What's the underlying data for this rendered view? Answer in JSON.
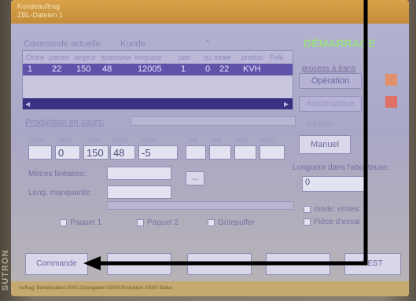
{
  "window": {
    "title_line1": "Kundeauftrag",
    "title_line2": "ZBL-Dateien 1"
  },
  "order": {
    "label": "Commande actuelle:",
    "value": "Kunde",
    "marker": "*"
  },
  "table": {
    "columns": [
      "Ordre",
      "pièces",
      "largeur",
      "épaisseur",
      "longueur",
      "part",
      "qu",
      "totale",
      "produit",
      "Polk"
    ],
    "row": [
      "1",
      "22",
      "150",
      "48",
      "12005",
      "1",
      "0",
      "22",
      "KVH",
      ""
    ]
  },
  "production": {
    "label": "Production en cours:",
    "headers": [
      "Comm.",
      "pièces",
      "largeur",
      "épaiss.",
      "longeur",
      "part",
      "quai",
      "totale",
      "produit"
    ],
    "values": [
      "",
      "0",
      "150",
      "48",
      "-5",
      "",
      "",
      "",
      ""
    ]
  },
  "metres": {
    "label": "Mètres linéaires:",
    "value": ""
  },
  "long": {
    "label": "Long. manquante:",
    "value": ""
  },
  "checkboxes": [
    "Paquet 1",
    "Paquet 2",
    "Gütepuffer"
  ],
  "right_panel": {
    "title": "DÉMARRAGE",
    "process_label": "process à trans",
    "operation_label": "Opération",
    "auto_label": "Automatique",
    "funktion_label": "Funktion",
    "manual_button": "Manuel",
    "longueur_label": "Longueur dans l'abouteuse:",
    "longueur_value": "0",
    "mode_label": "mode: restes",
    "piece_label": "Pièce d'essai"
  },
  "bottom_buttons": [
    "Commande",
    "",
    "",
    "",
    "TEST"
  ],
  "status": {
    "text": "Auftrag: Betriebsdaten 0000 Zeitangaben 00000 Produktion 00000 Status"
  },
  "colors": {
    "arrow": "#000000",
    "selected_row": "#5f53a9",
    "green_title": "#9bdc86",
    "indicator": "#e0916a"
  }
}
